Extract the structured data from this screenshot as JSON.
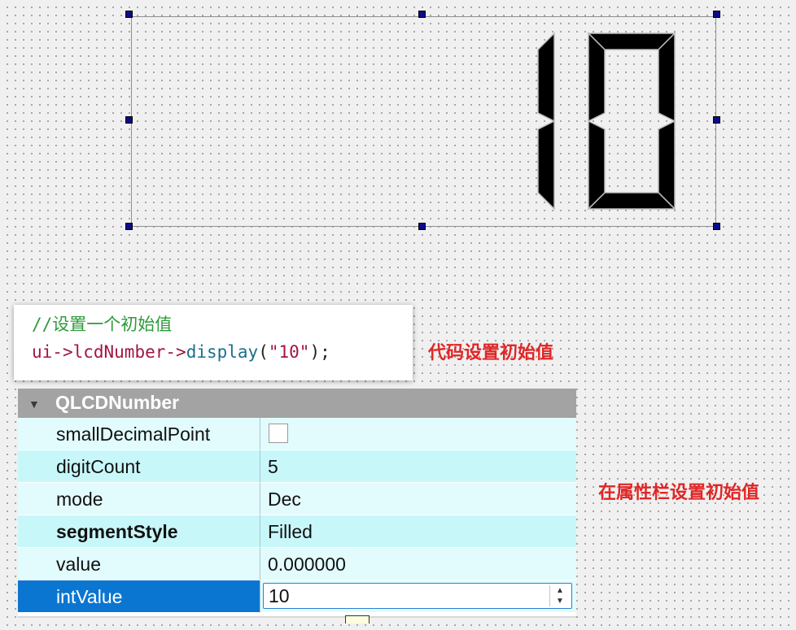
{
  "lcd": {
    "display_value": "10"
  },
  "code": {
    "comment": "//设置一个初始值",
    "ident": "ui",
    "arrow1": "->",
    "member": "lcdNumber",
    "arrow2": "->",
    "func": "display",
    "open": "(",
    "arg": "\"10\"",
    "close": ");"
  },
  "annotations": {
    "code_init": "代码设置初始值",
    "property_init": "在属性栏设置初始值"
  },
  "property_editor": {
    "class_name": "QLCDNumber",
    "rows": [
      {
        "name": "smallDecimalPoint",
        "value": ""
      },
      {
        "name": "digitCount",
        "value": "5"
      },
      {
        "name": "mode",
        "value": "Dec"
      },
      {
        "name": "segmentStyle",
        "value": "Filled"
      },
      {
        "name": "value",
        "value": "0.000000"
      },
      {
        "name": "intValue",
        "value": "10"
      }
    ]
  },
  "colors": {
    "selection": "#0b76d1",
    "annotation_red": "#e02626",
    "header_gray": "#a3a3a3",
    "row_cyan": "#c8f7fa",
    "row_light": "#e2fbfd"
  }
}
